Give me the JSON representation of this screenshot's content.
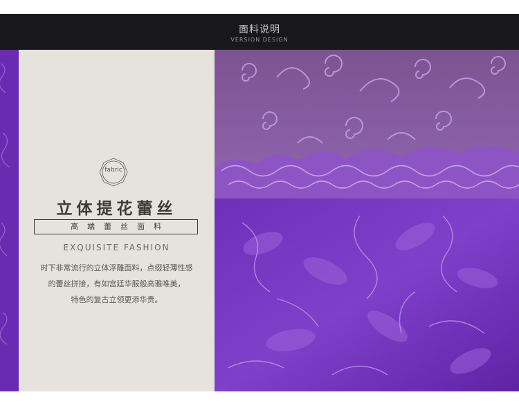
{
  "header": {
    "title": "面料说明",
    "subtitle": "VERSION DESIGN"
  },
  "panel": {
    "badge": "fabric",
    "title": "立体提花蕾丝",
    "framed_label": "高端蕾丝面料",
    "english": "EXQUISITE FASHION",
    "description": [
      "时下非常流行的立体浮雕面料，点缀轻薄性感",
      "的蕾丝拼接，有如宫廷华服般高雅唯美，",
      "特色的复古立领更添华贵。"
    ]
  },
  "colors": {
    "header_band": "#17171c",
    "panel": "#e6e3de",
    "lace_purple": "#6a2fb0",
    "lace_light": "#c9a4e6"
  }
}
